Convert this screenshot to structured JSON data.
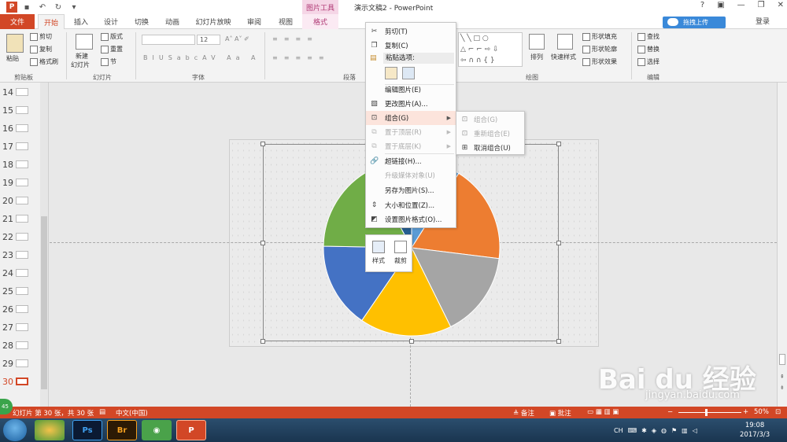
{
  "titlebar": {
    "app_logo": "P",
    "picture_tools": "图片工具",
    "window_title": "演示文稿2 - PowerPoint",
    "help": "?",
    "minimize": "—",
    "restore": "❐",
    "close": "✕"
  },
  "tabs": {
    "file": "文件",
    "home": "开始",
    "insert": "插入",
    "design": "设计",
    "transitions": "切换",
    "animations": "动画",
    "slideshow": "幻灯片放映",
    "review": "审阅",
    "view": "视图",
    "format": "格式",
    "upload": "拖拽上传",
    "login": "登录"
  },
  "ribbon": {
    "clipboard": {
      "paste": "粘贴",
      "cut": "剪切",
      "copy": "复制",
      "format_painter": "格式刷",
      "label": "剪贴板"
    },
    "slides": {
      "new_slide": "新建",
      "new_slide2": "幻灯片",
      "layout": "版式",
      "reset": "重置",
      "section": "节",
      "label": "幻灯片"
    },
    "font": {
      "size": "12",
      "label": "字体"
    },
    "paragraph": {
      "label": "段落"
    },
    "drawing": {
      "arrange": "排列",
      "quick_styles": "快速样式",
      "shape_fill": "形状填充",
      "shape_outline": "形状轮廓",
      "shape_effects": "形状效果",
      "label": "绘图"
    },
    "editing": {
      "find": "查找",
      "replace": "替换",
      "select": "选择",
      "label": "编辑"
    }
  },
  "thumbnails": [
    "14",
    "15",
    "16",
    "17",
    "18",
    "19",
    "20",
    "21",
    "22",
    "23",
    "24",
    "25",
    "26",
    "27",
    "28",
    "29",
    "30"
  ],
  "context_menu": {
    "cut": "剪切(T)",
    "copy": "复制(C)",
    "paste_options": "粘贴选项:",
    "edit_picture": "编辑图片(E)",
    "change_picture": "更改图片(A)...",
    "group": "组合(G)",
    "bring_front": "置于顶层(R)",
    "send_back": "置于底层(K)",
    "hyperlink": "超链接(H)...",
    "upgrade_media": "升级媒体对象(U)",
    "save_as_picture": "另存为图片(S)...",
    "size_position": "大小和位置(Z)...",
    "format_picture": "设置图片格式(O)..."
  },
  "submenu": {
    "group": "组合(G)",
    "regroup": "重新组合(E)",
    "ungroup": "取消组合(U)"
  },
  "mini_toolbar": {
    "style": "样式",
    "crop": "裁剪"
  },
  "statusbar": {
    "slide_info": "幻灯片 第 30 张，共 30 张",
    "language": "中文(中国)",
    "notes": "备注",
    "comments": "批注",
    "zoom": "50%",
    "badge": "45"
  },
  "taskbar": {
    "ps": "Ps",
    "br": "Br",
    "ppt": "P",
    "lang": "CH",
    "time": "19:08",
    "date": "2017/3/3"
  },
  "watermark": {
    "brand": "Bai du 经验",
    "url": "jingyan.baidu.com"
  },
  "chart_data": {
    "type": "pie",
    "title": "",
    "series": [
      {
        "values": [
          8,
          16,
          14,
          15,
          14,
          15,
          7
        ],
        "colors": [
          "#5b9bd5",
          "#ed7d31",
          "#a5a5a5",
          "#ffc000",
          "#4472c4",
          "#70ad47",
          "#255e91"
        ]
      }
    ]
  }
}
